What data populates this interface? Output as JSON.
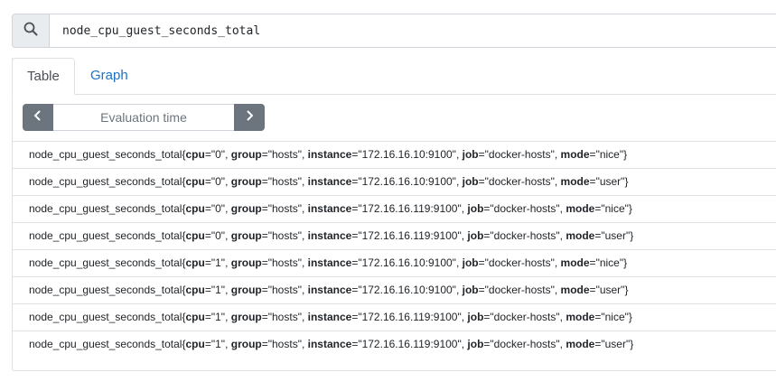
{
  "search": {
    "value": "node_cpu_guest_seconds_total"
  },
  "tabs": [
    {
      "label": "Table"
    },
    {
      "label": "Graph"
    }
  ],
  "eval": {
    "placeholder": "Evaluation time"
  },
  "results": [
    {
      "metric": "node_cpu_guest_seconds_total",
      "cpu": "\"0\"",
      "group": "\"hosts\"",
      "instance": "\"172.16.16.10:9100\"",
      "job": "\"docker-hosts\"",
      "mode": "\"nice\""
    },
    {
      "metric": "node_cpu_guest_seconds_total",
      "cpu": "\"0\"",
      "group": "\"hosts\"",
      "instance": "\"172.16.16.10:9100\"",
      "job": "\"docker-hosts\"",
      "mode": "\"user\""
    },
    {
      "metric": "node_cpu_guest_seconds_total",
      "cpu": "\"0\"",
      "group": "\"hosts\"",
      "instance": "\"172.16.16.119:9100\"",
      "job": "\"docker-hosts\"",
      "mode": "\"nice\""
    },
    {
      "metric": "node_cpu_guest_seconds_total",
      "cpu": "\"0\"",
      "group": "\"hosts\"",
      "instance": "\"172.16.16.119:9100\"",
      "job": "\"docker-hosts\"",
      "mode": "\"user\""
    },
    {
      "metric": "node_cpu_guest_seconds_total",
      "cpu": "\"1\"",
      "group": "\"hosts\"",
      "instance": "\"172.16.16.10:9100\"",
      "job": "\"docker-hosts\"",
      "mode": "\"nice\""
    },
    {
      "metric": "node_cpu_guest_seconds_total",
      "cpu": "\"1\"",
      "group": "\"hosts\"",
      "instance": "\"172.16.16.10:9100\"",
      "job": "\"docker-hosts\"",
      "mode": "\"user\""
    },
    {
      "metric": "node_cpu_guest_seconds_total",
      "cpu": "\"1\"",
      "group": "\"hosts\"",
      "instance": "\"172.16.16.119:9100\"",
      "job": "\"docker-hosts\"",
      "mode": "\"nice\""
    },
    {
      "metric": "node_cpu_guest_seconds_total",
      "cpu": "\"1\"",
      "group": "\"hosts\"",
      "instance": "\"172.16.16.119:9100\"",
      "job": "\"docker-hosts\"",
      "mode": "\"user\""
    }
  ],
  "label_keys": [
    "cpu",
    "group",
    "instance",
    "job",
    "mode"
  ],
  "colors": {
    "accent": "#1a73c8",
    "button": "#6c757d"
  }
}
